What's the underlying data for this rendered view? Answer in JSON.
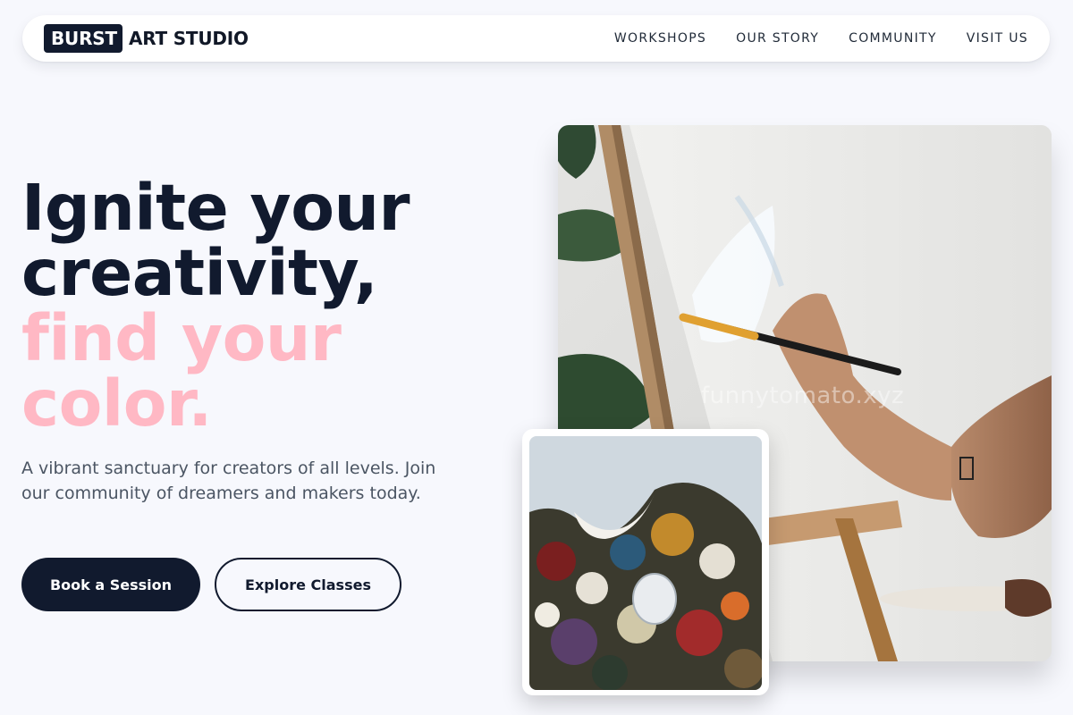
{
  "brand": {
    "badge": "BURST",
    "name": "ART STUDIO"
  },
  "nav": [
    "WORKSHOPS",
    "OUR STORY",
    "COMMUNITY",
    "VISIT US"
  ],
  "hero": {
    "line1": "Ignite your",
    "line2": "creativity,",
    "line3": "find your",
    "line4": "color.",
    "subtitle": "A vibrant sanctuary for creators of all levels. Join our community of dreamers and makers today.",
    "primary_cta": "Book a Session",
    "secondary_cta": "Explore Classes"
  },
  "images": {
    "main_watermark": "funnytomato.xyz"
  },
  "colors": {
    "navy": "#111a2e",
    "pink": "#ffb8c4",
    "background": "#f7f8fd"
  }
}
